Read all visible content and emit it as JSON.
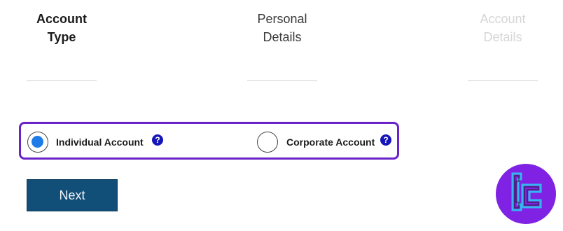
{
  "steps": [
    {
      "line1": "Account",
      "line2": "Type",
      "state": "active"
    },
    {
      "line1": "Personal",
      "line2": "Details",
      "state": "next"
    },
    {
      "line1": "Account",
      "line2": "Details",
      "state": "disabled"
    }
  ],
  "account_type": {
    "options": [
      {
        "label": "Individual Account",
        "selected": true,
        "help_icon": "?"
      },
      {
        "label": "Corporate Account",
        "selected": false,
        "help_icon": "?"
      }
    ],
    "border_color": "#6a22c9",
    "selected_color": "#1e7be8",
    "help_icon_color": "#1515b8"
  },
  "actions": {
    "next_label": "Next",
    "next_color": "#114f79"
  },
  "logo": {
    "icon": "tc-brand-logo",
    "background_color": "#7f22e3",
    "accent_color": "#35b5f0"
  }
}
